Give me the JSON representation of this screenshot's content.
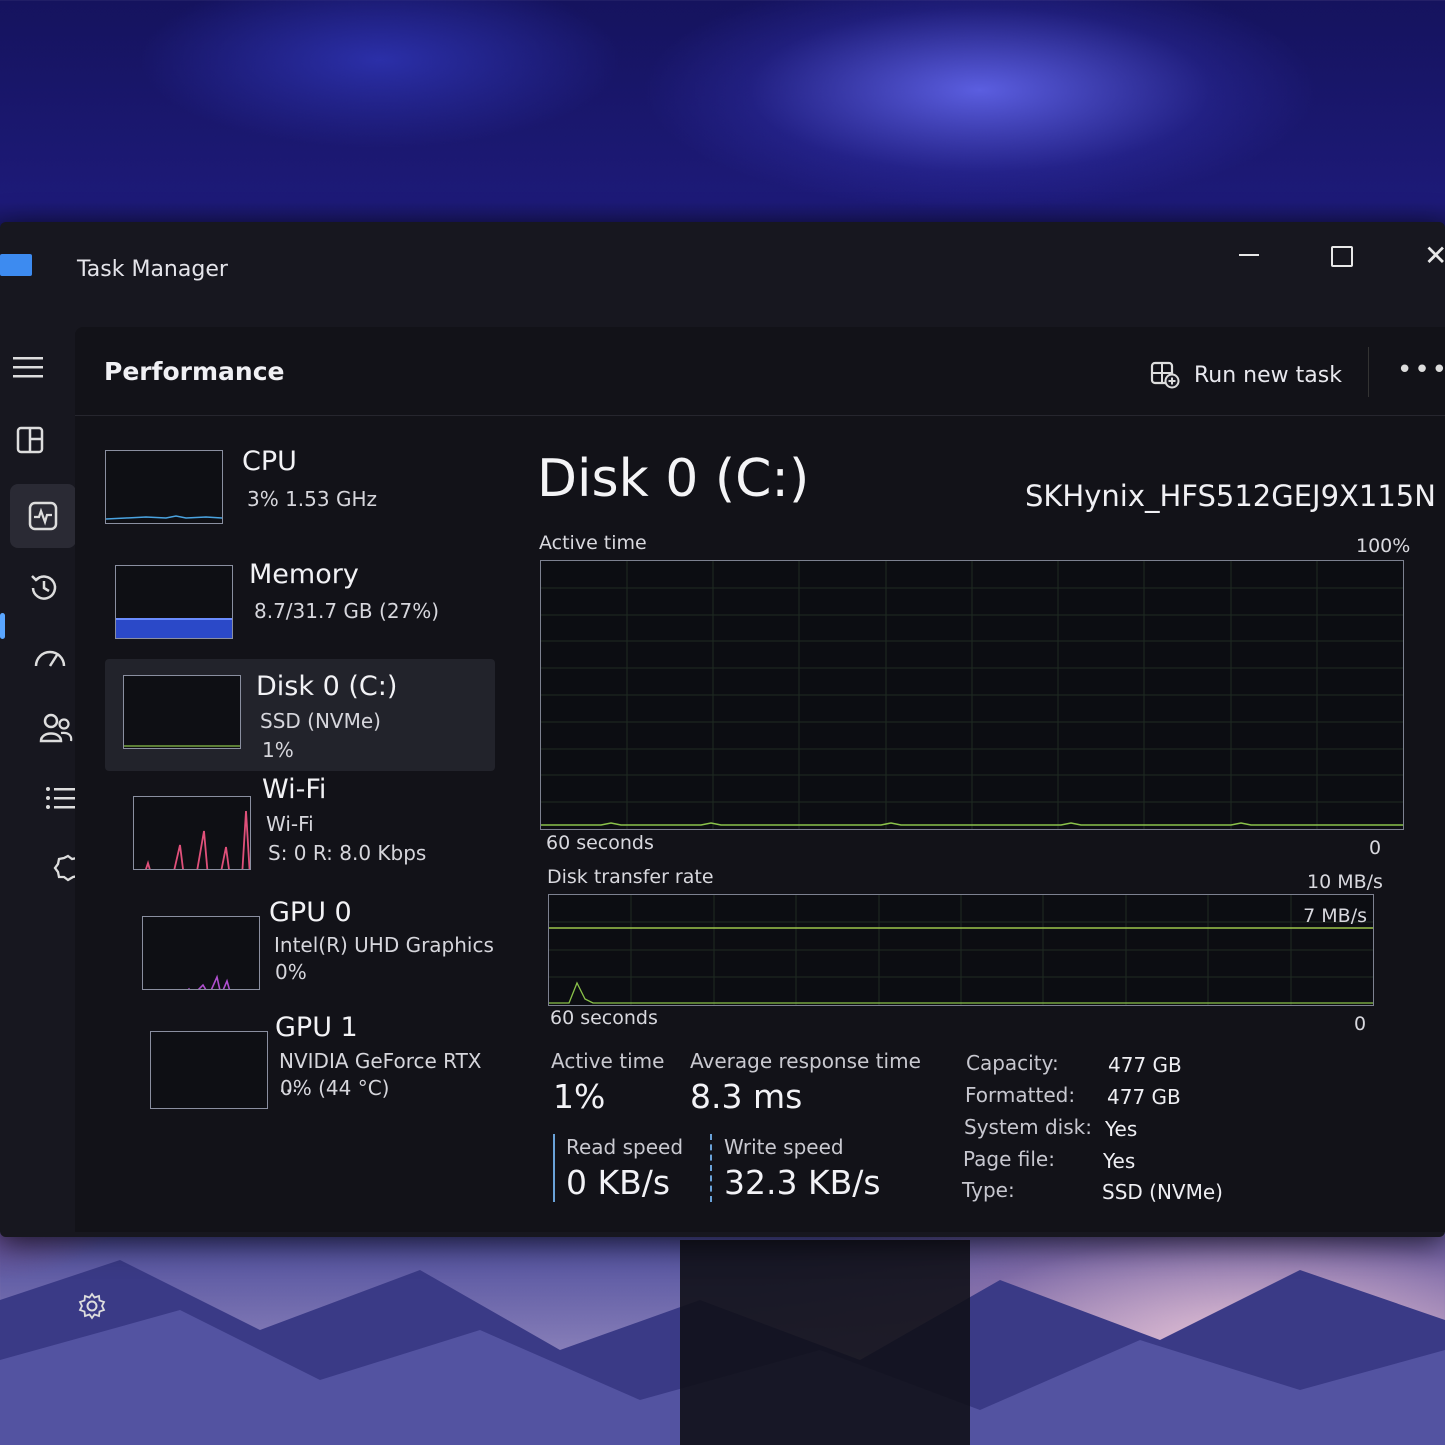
{
  "window": {
    "title": "Task Manager"
  },
  "header": {
    "page_title": "Performance",
    "run_new_task": "Run new task",
    "more": "•••"
  },
  "devices": [
    {
      "name": "CPU",
      "line1": "3%  1.53 GHz",
      "line2": ""
    },
    {
      "name": "Memory",
      "line1": "8.7/31.7 GB (27%)",
      "line2": ""
    },
    {
      "name": "Disk 0 (C:)",
      "line1": "SSD (NVMe)",
      "line2": "1%"
    },
    {
      "name": "Wi-Fi",
      "line1": "Wi-Fi",
      "line2": "S: 0  R: 8.0 Kbps"
    },
    {
      "name": "GPU 0",
      "line1": "Intel(R) UHD Graphics",
      "line2": "0%"
    },
    {
      "name": "GPU 1",
      "line1": "NVIDIA GeForce RTX ...",
      "line2": "0%  (44 °C)"
    }
  ],
  "detail": {
    "title": "Disk 0 (C:)",
    "model": "SKHynix_HFS512GEJ9X115N",
    "active_graph": {
      "label": "Active time",
      "max": "100%",
      "time": "60 seconds",
      "min": "0"
    },
    "transfer_graph": {
      "label": "Disk transfer rate",
      "max": "10 MB/s",
      "line_label": "7 MB/s",
      "time": "60 seconds",
      "min": "0"
    },
    "stats": {
      "active_time_label": "Active time",
      "active_time": "1%",
      "response_label": "Average response time",
      "response": "8.3 ms",
      "read_label": "Read speed",
      "read": "0 KB/s",
      "write_label": "Write speed",
      "write": "32.3 KB/s"
    },
    "props": [
      {
        "k": "Capacity:",
        "v": "477 GB"
      },
      {
        "k": "Formatted:",
        "v": "477 GB"
      },
      {
        "k": "System disk:",
        "v": "Yes"
      },
      {
        "k": "Page file:",
        "v": "Yes"
      },
      {
        "k": "Type:",
        "v": "SSD (NVMe)"
      }
    ]
  },
  "colors": {
    "accent": "#5aa6ff",
    "memory_fill": "#2b49c8",
    "wifi_line": "#e0507a",
    "disk_line": "#8ac24a"
  }
}
